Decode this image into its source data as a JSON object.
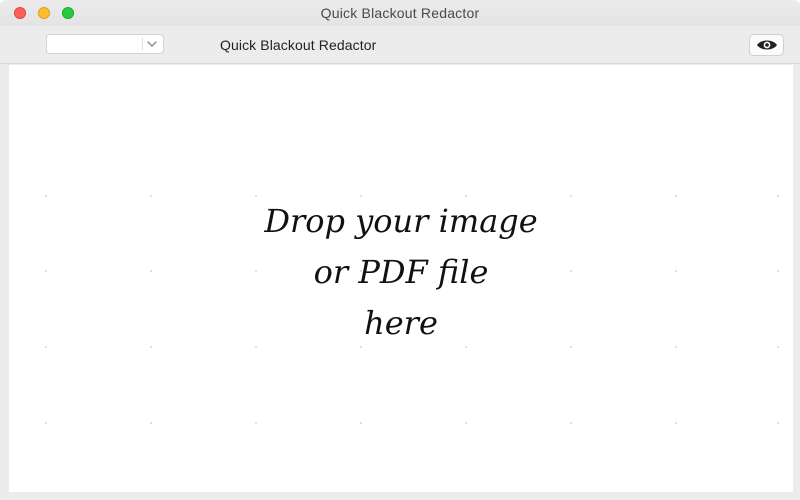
{
  "window": {
    "title": "Quick Blackout Redactor"
  },
  "toolbar": {
    "select_value": "",
    "title": "Quick Blackout Redactor",
    "preview_icon": "eye-icon"
  },
  "drop_zone": {
    "lines": [
      "Drop your image",
      "or PDF file",
      "here"
    ]
  },
  "colors": {
    "close": "#fe5f57",
    "minimize": "#febc2e",
    "zoom": "#28c840",
    "chrome": "#ececec"
  }
}
